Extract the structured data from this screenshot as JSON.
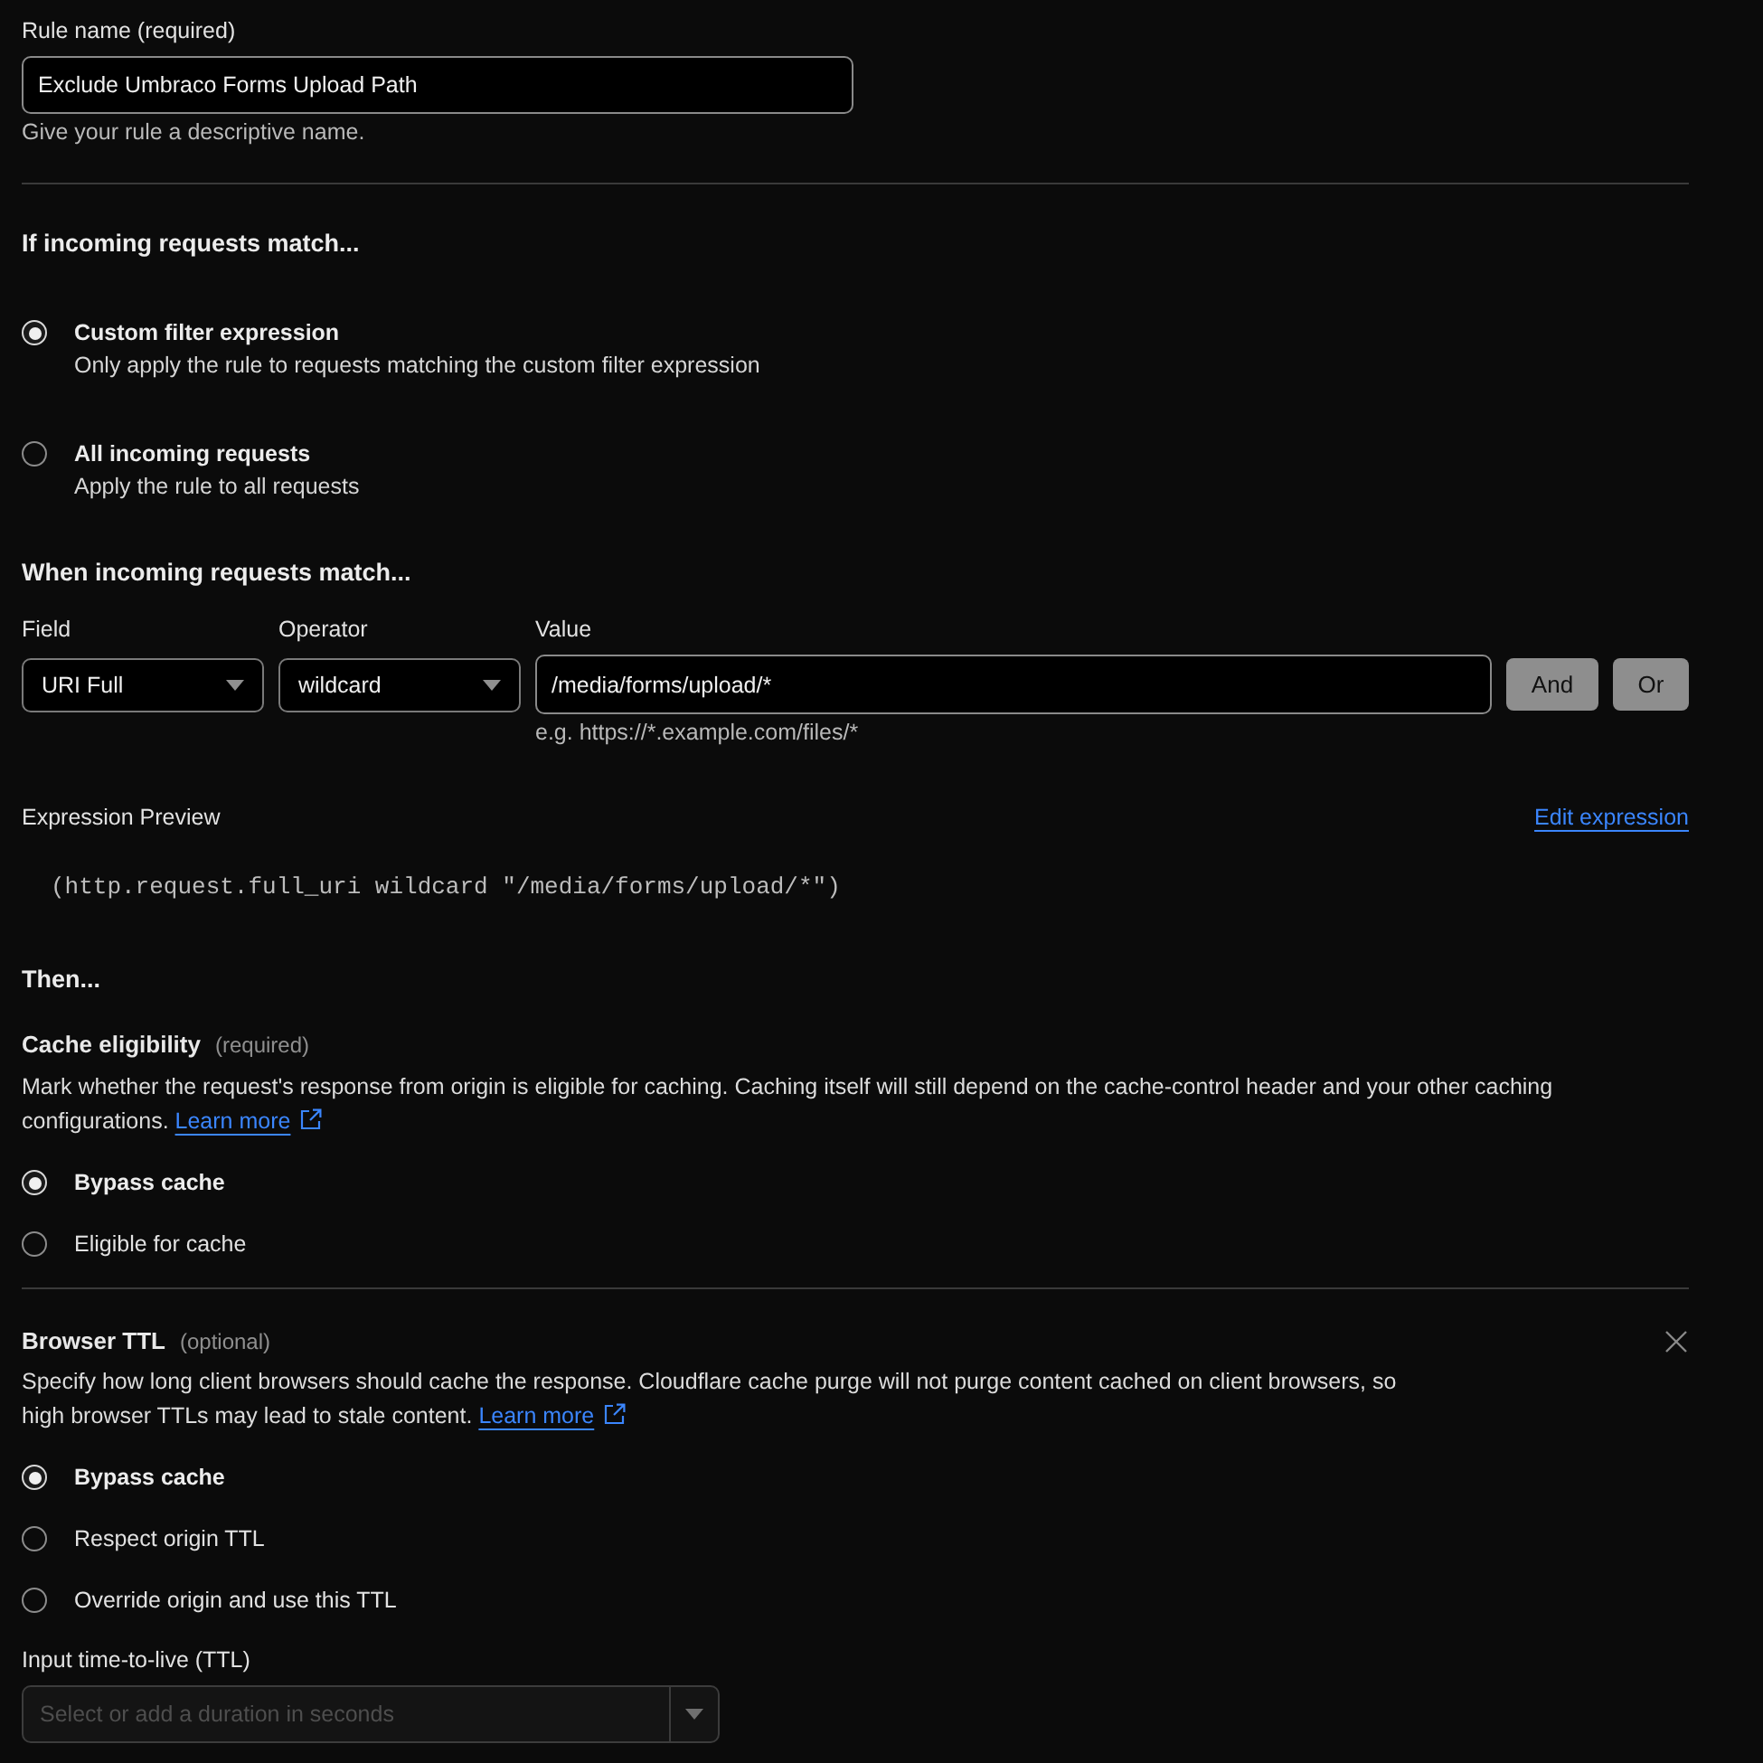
{
  "rule_name": {
    "label": "Rule name (required)",
    "value": "Exclude Umbraco Forms Upload Path",
    "hint": "Give your rule a descriptive name."
  },
  "match_mode": {
    "heading": "If incoming requests match...",
    "options": [
      {
        "label": "Custom filter expression",
        "description": "Only apply the rule to requests matching the custom filter expression",
        "selected": true
      },
      {
        "label": "All incoming requests",
        "description": "Apply the rule to all requests",
        "selected": false
      }
    ]
  },
  "expression_builder": {
    "heading": "When incoming requests match...",
    "field": {
      "label": "Field",
      "value": "URI Full"
    },
    "operator": {
      "label": "Operator",
      "value": "wildcard"
    },
    "value": {
      "label": "Value",
      "value": "/media/forms/upload/*",
      "hint": "e.g. https://*.example.com/files/*"
    },
    "buttons": [
      "And",
      "Or"
    ]
  },
  "expression_preview": {
    "label": "Expression Preview",
    "link": "Edit expression",
    "code": "(http.request.full_uri wildcard \"/media/forms/upload/*\")"
  },
  "then_heading": "Then...",
  "settings": [
    {
      "title": "Cache eligibility",
      "note": "(required)",
      "description": "Mark whether the request's response from origin is eligible for caching. Caching itself will still depend on the cache-control header and your other caching configurations.",
      "link": "Learn more",
      "removable": false,
      "options": [
        {
          "label": "Bypass cache",
          "selected": true
        },
        {
          "label": "Eligible for cache",
          "selected": false
        }
      ]
    },
    {
      "title": "Browser TTL",
      "note": "(optional)",
      "description": "Specify how long client browsers should cache the response. Cloudflare cache purge will not purge content cached on client browsers, so high browser TTLs may lead to stale content.",
      "link": "Learn more",
      "removable": true,
      "options": [
        {
          "label": "Bypass cache",
          "selected": true
        },
        {
          "label": "Respect origin TTL",
          "selected": false
        },
        {
          "label": "Override origin and use this TTL",
          "selected": false
        }
      ],
      "ttl_input": {
        "label": "Input time-to-live (TTL)",
        "placeholder": "Select or add a duration in seconds",
        "disabled": true
      }
    }
  ]
}
